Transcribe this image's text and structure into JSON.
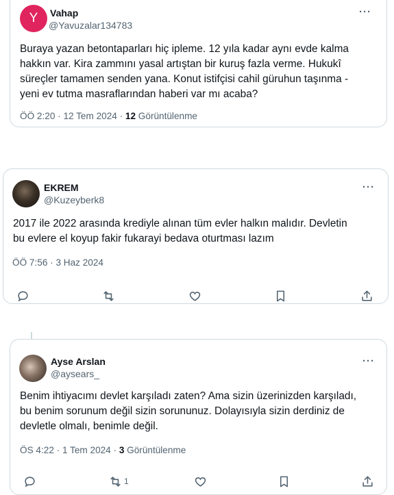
{
  "tweets": [
    {
      "avatar_letter": "Y",
      "name": "Vahap",
      "handle": "@Yavuzalar134783",
      "more": "···",
      "lines": [
        "Buraya yazan betontaparları hiç ipleme. 12 yıla kadar aynı evde  kalma",
        "hakkın var. Kira zammını yasal artıştan bir kuruş fazla verme. Hukukî",
        "süreçler tamamen senden yana. Konut istifçisi cahil güruhun taşınma -",
        "yeni ev tutma masraflarından haberi var mı acaba?"
      ],
      "meta_time": "ÖÖ 2:20 · 12 Tem 2024 · ",
      "views": "12",
      "views_label": " Görüntülenme"
    },
    {
      "name": "EKREM",
      "handle": "@Kuzeyberk8",
      "more": "···",
      "lines": [
        "2017 ile 2022 arasında krediyle alınan tüm evler halkın malıdır. Devletin",
        "bu evlere el koyup fakir fukarayi bedava oturtması lazım"
      ],
      "meta_time": "ÖÖ 7:56 · 3 Haz 2024",
      "actions": [
        "reply-icon",
        "retweet-icon",
        "like-icon",
        "bookmark-icon",
        "share-icon"
      ]
    },
    {
      "name": "Ayse Arslan",
      "handle": "@aysears_",
      "more": "···",
      "lines": [
        "Benim ihtiyacımı devlet karşıladı zaten? Ama sizin üzerinizden karşıladı,",
        "bu benim sorunum değil sizin sorununuz. Dolayısıyla sizin derdiniz de",
        "devletle olmalı, benimle değil."
      ],
      "meta_time": "ÖS 4:22 · 1 Tem 2024 · ",
      "views": "3",
      "views_label": " Görüntülenme",
      "retweet_count": "1",
      "actions": [
        "reply-icon",
        "retweet-icon",
        "like-icon",
        "bookmark-icon",
        "share-icon"
      ]
    }
  ],
  "colors": {
    "accent_avatar": "#e0245e",
    "text": "#0f1419",
    "secondary": "#536471",
    "border": "#cfd9de"
  }
}
